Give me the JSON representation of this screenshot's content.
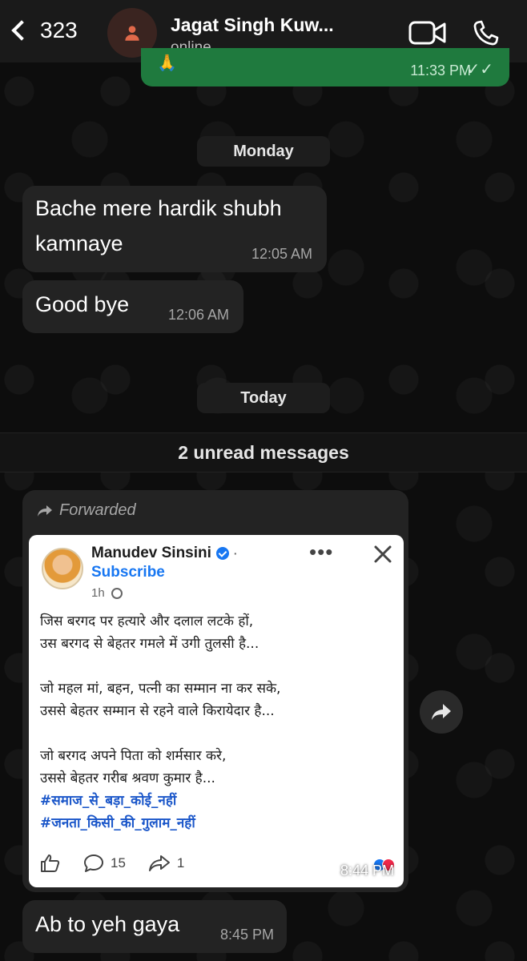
{
  "header": {
    "back_count": "323",
    "contact_name": "Jagat Singh Kuw...",
    "status": "online"
  },
  "top_outgoing": {
    "emoji": "🙏",
    "time": "11:33 PM",
    "ticks": "✓✓"
  },
  "dates": {
    "monday": "Monday",
    "today": "Today"
  },
  "messages": [
    {
      "text_line1": "Bache mere hardik shubh",
      "text_line2": "kamnaye",
      "time": "12:05 AM"
    },
    {
      "text": "Good bye",
      "time": "12:06 AM"
    }
  ],
  "unread": "2 unread messages",
  "forwarded": {
    "label": "Forwarded",
    "post": {
      "author": "Manudev Sinsini",
      "subscribe": "Subscribe",
      "age": "1h",
      "lines": [
        "जिस बरगद पर हत्यारे और दलाल लटके हों,",
        "उस बरगद से बेहतर गमले में उगी तुलसी है...",
        "जो महल मां, बहन, पत्नी का सम्मान ना कर सके,",
        "उससे बेहतर सम्मान से रहने वाले किरायेदार है...",
        "जो बरगद अपने पिता को शर्मसार करे,",
        "उससे बेहतर गरीब श्रवण कुमार है..."
      ],
      "hashtags": [
        "#समाज_से_बड़ा_कोई_नहीं",
        "#जनता_किसी_की_गुलाम_नहीं"
      ],
      "comments": "15",
      "shares": "1"
    },
    "time": "8:44 PM"
  },
  "last_message": {
    "text": "Ab to yeh gaya",
    "time": "8:45 PM"
  },
  "colors": {
    "outgoing": "#1f7a3e",
    "incoming": "#232323",
    "hashtag": "#1a56c9",
    "subscribe": "#1877f2"
  }
}
